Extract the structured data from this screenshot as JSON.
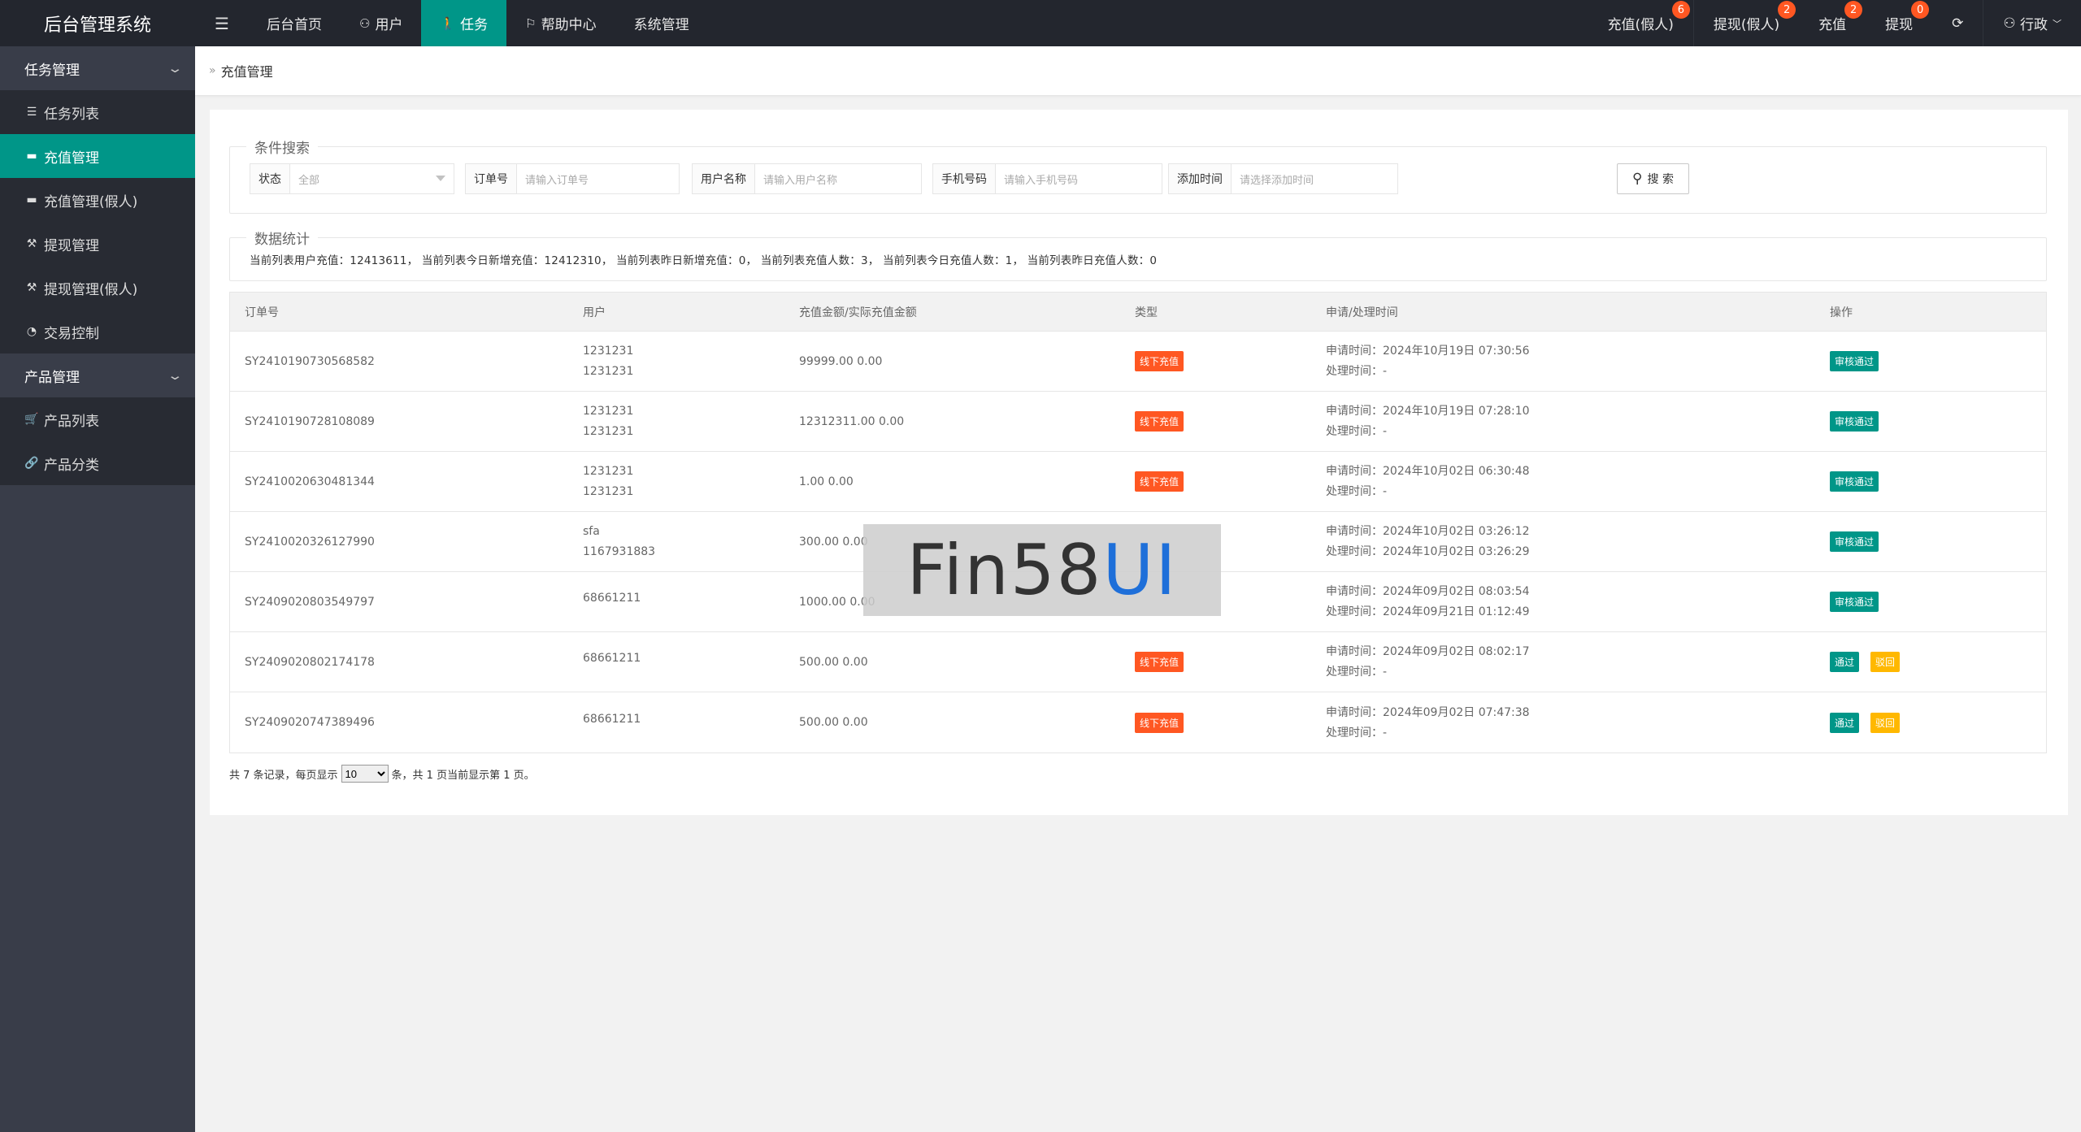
{
  "app_title": "后台管理系统",
  "topnav": [
    {
      "label": "后台首页",
      "icon": "",
      "active": false
    },
    {
      "label": "用户",
      "icon": "user-icon",
      "active": false
    },
    {
      "label": "任务",
      "icon": "walk-icon",
      "active": true
    },
    {
      "label": "帮助中心",
      "icon": "flag-icon",
      "active": false
    },
    {
      "label": "系统管理",
      "icon": "",
      "active": false
    }
  ],
  "rightnav": [
    {
      "label": "充值(假人)",
      "badge": "6"
    },
    {
      "label": "提现(假人)",
      "badge": "2"
    },
    {
      "label": "充值",
      "badge": "2"
    },
    {
      "label": "提现",
      "badge": "0"
    },
    {
      "label": "⟳",
      "badge": ""
    },
    {
      "label": "行政",
      "badge": ""
    }
  ],
  "sidebar": {
    "group1": "任务管理",
    "group1_items": [
      {
        "label": "任务列表",
        "icon": "list-icon"
      },
      {
        "label": "充值管理",
        "icon": "chat-icon"
      },
      {
        "label": "充值管理(假人)",
        "icon": "chat-icon"
      },
      {
        "label": "提现管理",
        "icon": "hammer-icon"
      },
      {
        "label": "提现管理(假人)",
        "icon": "hammer-icon"
      },
      {
        "label": "交易控制",
        "icon": "gauge-icon"
      }
    ],
    "group2": "产品管理",
    "group2_items": [
      {
        "label": "产品列表",
        "icon": "cart-icon"
      },
      {
        "label": "产品分类",
        "icon": "link-icon"
      }
    ]
  },
  "breadcrumb": "充值管理",
  "search": {
    "legend": "条件搜索",
    "status_label": "状态",
    "status_value": "全部",
    "order_label": "订单号",
    "order_placeholder": "请输入订单号",
    "user_label": "用户名称",
    "user_placeholder": "请输入用户名称",
    "phone_label": "手机号码",
    "phone_placeholder": "请输入手机号码",
    "time_label": "添加时间",
    "time_placeholder": "请选择添加时间",
    "button": "搜 索"
  },
  "stats": {
    "legend": "数据统计",
    "text": "当前列表用户充值：12413611， 当前列表今日新增充值：12412310， 当前列表昨日新增充值：0， 当前列表充值人数：3， 当前列表今日充值人数：1， 当前列表昨日充值人数：0"
  },
  "table": {
    "headers": [
      "订单号",
      "用户",
      "充值金额/实际充值金额",
      "类型",
      "申请/处理时间",
      "操作"
    ],
    "rows": [
      {
        "order": "SY2410190730568582",
        "user1": "1231231",
        "user2": "1231231",
        "amount": "99999.00 0.00",
        "type": "线下充值",
        "apply": "申请时间：2024年10月19日 07:30:56",
        "handle": "处理时间：-",
        "actions": [
          "审核通过"
        ]
      },
      {
        "order": "SY2410190728108089",
        "user1": "1231231",
        "user2": "1231231",
        "amount": "12312311.00 0.00",
        "type": "线下充值",
        "apply": "申请时间：2024年10月19日 07:28:10",
        "handle": "处理时间：-",
        "actions": [
          "审核通过"
        ]
      },
      {
        "order": "SY2410020630481344",
        "user1": "1231231",
        "user2": "1231231",
        "amount": "1.00 0.00",
        "type": "线下充值",
        "apply": "申请时间：2024年10月02日 06:30:48",
        "handle": "处理时间：-",
        "actions": [
          "审核通过"
        ]
      },
      {
        "order": "SY2410020326127990",
        "user1": "sfa",
        "user2": "1167931883",
        "amount": "300.00 0.00",
        "type": "",
        "apply": "申请时间：2024年10月02日 03:26:12",
        "handle": "处理时间：2024年10月02日 03:26:29",
        "actions": [
          "审核通过"
        ]
      },
      {
        "order": "SY2409020803549797",
        "user1": "68661211",
        "user2": "",
        "amount": "1000.00 0.00",
        "type": "",
        "apply": "申请时间：2024年09月02日 08:03:54",
        "handle": "处理时间：2024年09月21日 01:12:49",
        "actions": [
          "审核通过"
        ]
      },
      {
        "order": "SY2409020802174178",
        "user1": "68661211",
        "user2": "",
        "amount": "500.00 0.00",
        "type": "线下充值",
        "apply": "申请时间：2024年09月02日 08:02:17",
        "handle": "处理时间：-",
        "actions": [
          "通过",
          "驳回"
        ]
      },
      {
        "order": "SY2409020747389496",
        "user1": "68661211",
        "user2": "",
        "amount": "500.00 0.00",
        "type": "线下充值",
        "apply": "申请时间：2024年09月02日 07:47:38",
        "handle": "处理时间：-",
        "actions": [
          "通过",
          "驳回"
        ]
      }
    ]
  },
  "pager": {
    "prefix": "共 7 条记录，每页显示",
    "page_size": "10",
    "suffix": "条，共 1 页当前显示第 1 页。"
  },
  "watermark": {
    "part1": "Fin58",
    "part2": "UI"
  }
}
